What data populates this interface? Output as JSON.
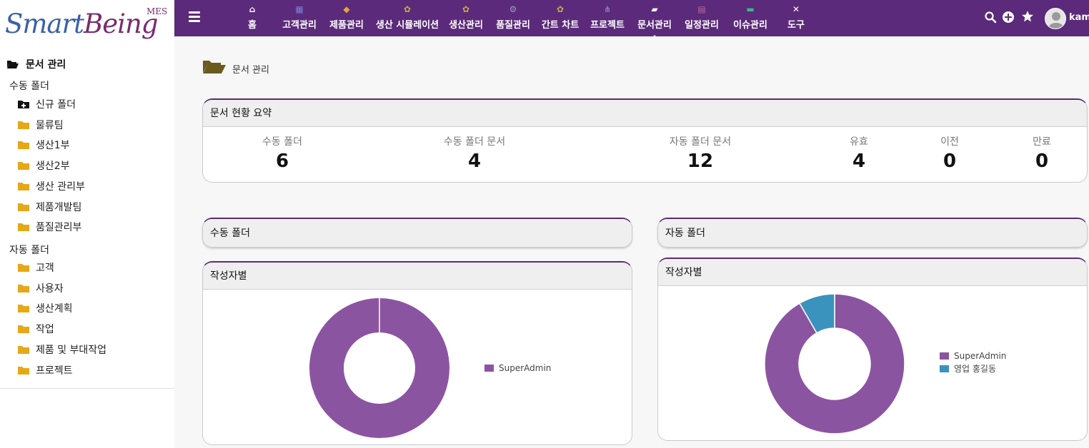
{
  "logo": {
    "smart": "Smart",
    "being": "Being",
    "mes": "MES"
  },
  "nav": {
    "items": [
      {
        "label": "홈",
        "icon": "home-icon"
      },
      {
        "label": "고객관리",
        "icon": "building-icon"
      },
      {
        "label": "제품관리",
        "icon": "box-icon"
      },
      {
        "label": "생산 시뮬레이션",
        "icon": "cubes-icon"
      },
      {
        "label": "생산관리",
        "icon": "cubes-icon"
      },
      {
        "label": "품질관리",
        "icon": "cogs-icon"
      },
      {
        "label": "간트 차트",
        "icon": "cubes-icon"
      },
      {
        "label": "프로젝트",
        "icon": "project-diagram-icon"
      },
      {
        "label": "문서관리",
        "icon": "folder-open-icon"
      },
      {
        "label": "일정관리",
        "icon": "calendar-icon"
      },
      {
        "label": "이슈관리",
        "icon": "ticket-icon"
      },
      {
        "label": "도구",
        "icon": "tools-icon"
      }
    ],
    "active_index": 8,
    "user": "kame"
  },
  "sidebar": {
    "title": "문서 관리",
    "manual_group": "수동 폴더",
    "manual_items": [
      {
        "label": "신규 폴더",
        "icon": "folder-plus-icon"
      },
      {
        "label": "물류팀",
        "icon": "folder-icon"
      },
      {
        "label": "생산1부",
        "icon": "folder-icon"
      },
      {
        "label": "생산2부",
        "icon": "folder-icon"
      },
      {
        "label": "생산 관리부",
        "icon": "folder-icon"
      },
      {
        "label": "제품개발팀",
        "icon": "folder-icon"
      },
      {
        "label": "품질관리부",
        "icon": "folder-icon"
      }
    ],
    "auto_group": "자동 폴더",
    "auto_items": [
      {
        "label": "고객",
        "icon": "folder-icon"
      },
      {
        "label": "사용자",
        "icon": "folder-icon"
      },
      {
        "label": "생산계획",
        "icon": "folder-icon"
      },
      {
        "label": "작업",
        "icon": "folder-icon"
      },
      {
        "label": "제품 및 부대작업",
        "icon": "folder-icon"
      },
      {
        "label": "프로젝트",
        "icon": "folder-icon"
      }
    ]
  },
  "breadcrumb": {
    "label": "문서 관리"
  },
  "summary": {
    "title": "문서 현황 요약",
    "stats": [
      {
        "label": "수동 폴더",
        "value": "6"
      },
      {
        "label": "수동 폴더 문서",
        "value": "4"
      },
      {
        "label": "자동 폴더 문서",
        "value": "12"
      },
      {
        "label": "유효",
        "value": "4"
      },
      {
        "label": "이전",
        "value": "0"
      },
      {
        "label": "만료",
        "value": "0"
      }
    ]
  },
  "panels": {
    "manual_title": "수동 폴더",
    "auto_title": "자동 폴더",
    "manual_chart_title": "작성자별",
    "auto_chart_title": "작성자별"
  },
  "colors": {
    "accent": "#5b2a7a",
    "series1": "#8b54a1",
    "series2": "#3a93bd",
    "folder": "#e6a817"
  },
  "chart_data": [
    {
      "type": "pie",
      "title": "작성자별",
      "donut": true,
      "categories": [
        "SuperAdmin"
      ],
      "values": [
        4
      ],
      "legend": "right"
    },
    {
      "type": "pie",
      "title": "작성자별",
      "donut": true,
      "categories": [
        "SuperAdmin",
        "영업 홍길동"
      ],
      "values": [
        11,
        1
      ],
      "legend": "right"
    }
  ]
}
